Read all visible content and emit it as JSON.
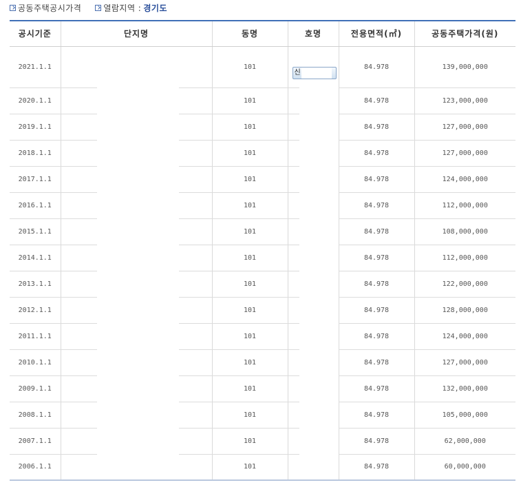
{
  "header": {
    "title": "공동주택공시가격",
    "region_label": "열람지역 :",
    "region_value": "경기도"
  },
  "table": {
    "columns": [
      "공시기준",
      "단지명",
      "동명",
      "호명",
      "전용면적(㎡)",
      "공동주택가격(원)"
    ],
    "select_button_label": "신",
    "rows": [
      {
        "date": "2021.1.1",
        "dong": "101",
        "area": "84.978",
        "price": "139,000,000"
      },
      {
        "date": "2020.1.1",
        "dong": "101",
        "area": "84.978",
        "price": "123,000,000"
      },
      {
        "date": "2019.1.1",
        "dong": "101",
        "area": "84.978",
        "price": "127,000,000"
      },
      {
        "date": "2018.1.1",
        "dong": "101",
        "area": "84.978",
        "price": "127,000,000"
      },
      {
        "date": "2017.1.1",
        "dong": "101",
        "area": "84.978",
        "price": "124,000,000"
      },
      {
        "date": "2016.1.1",
        "dong": "101",
        "area": "84.978",
        "price": "112,000,000"
      },
      {
        "date": "2015.1.1",
        "dong": "101",
        "area": "84.978",
        "price": "108,000,000"
      },
      {
        "date": "2014.1.1",
        "dong": "101",
        "area": "84.978",
        "price": "112,000,000"
      },
      {
        "date": "2013.1.1",
        "dong": "101",
        "area": "84.978",
        "price": "122,000,000"
      },
      {
        "date": "2012.1.1",
        "dong": "101",
        "area": "84.978",
        "price": "128,000,000"
      },
      {
        "date": "2011.1.1",
        "dong": "101",
        "area": "84.978",
        "price": "124,000,000"
      },
      {
        "date": "2010.1.1",
        "dong": "101",
        "area": "84.978",
        "price": "127,000,000"
      },
      {
        "date": "2009.1.1",
        "dong": "101",
        "area": "84.978",
        "price": "132,000,000"
      },
      {
        "date": "2008.1.1",
        "dong": "101",
        "area": "84.978",
        "price": "105,000,000"
      },
      {
        "date": "2007.1.1",
        "dong": "101",
        "area": "84.978",
        "price": "62,000,000"
      },
      {
        "date": "2006.1.1",
        "dong": "101",
        "area": "84.978",
        "price": "60,000,000"
      }
    ]
  }
}
